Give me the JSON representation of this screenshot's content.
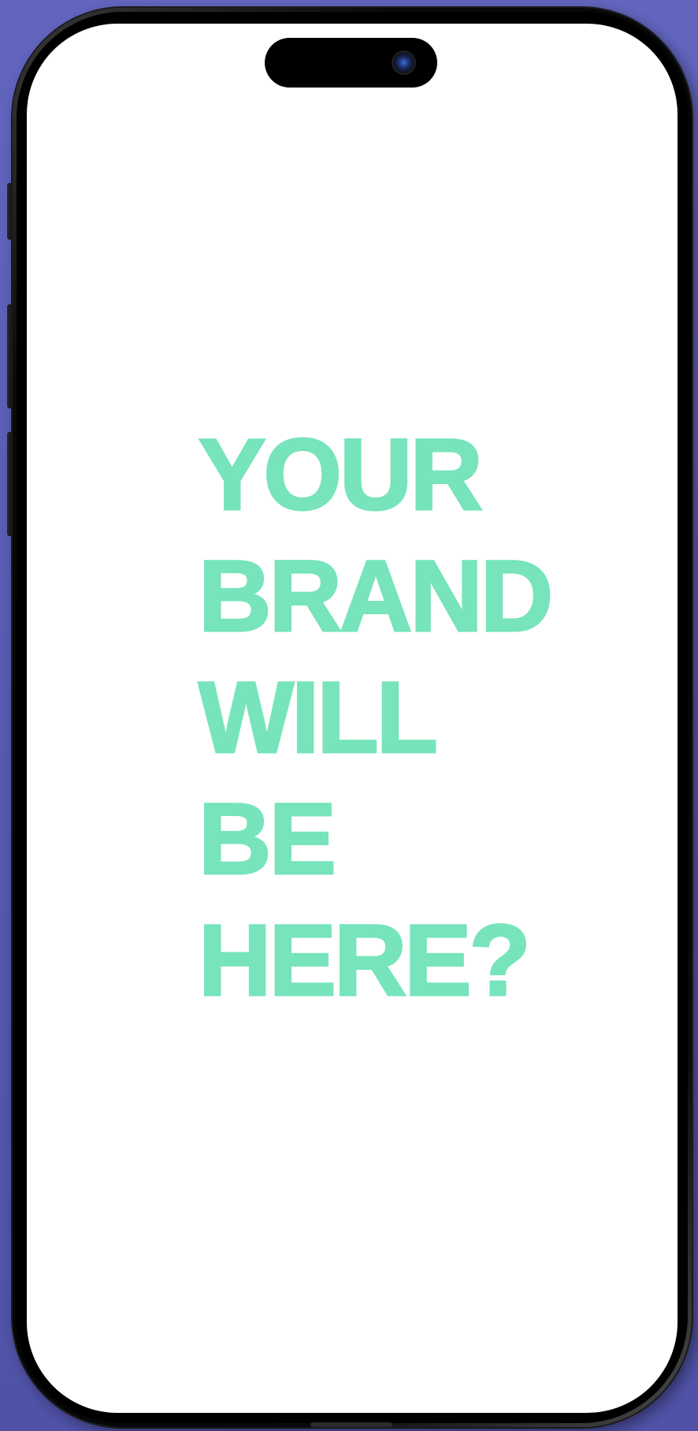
{
  "device": {
    "type": "phone-mockup",
    "backdrop_color": "#5a5db5",
    "frame_color": "#000000",
    "screen_color": "#ffffff"
  },
  "screen": {
    "headline_lines": [
      "YOUR",
      "BRAND",
      "WILL",
      "BE",
      "HERE?"
    ],
    "headline_color": "#77e4bb"
  }
}
